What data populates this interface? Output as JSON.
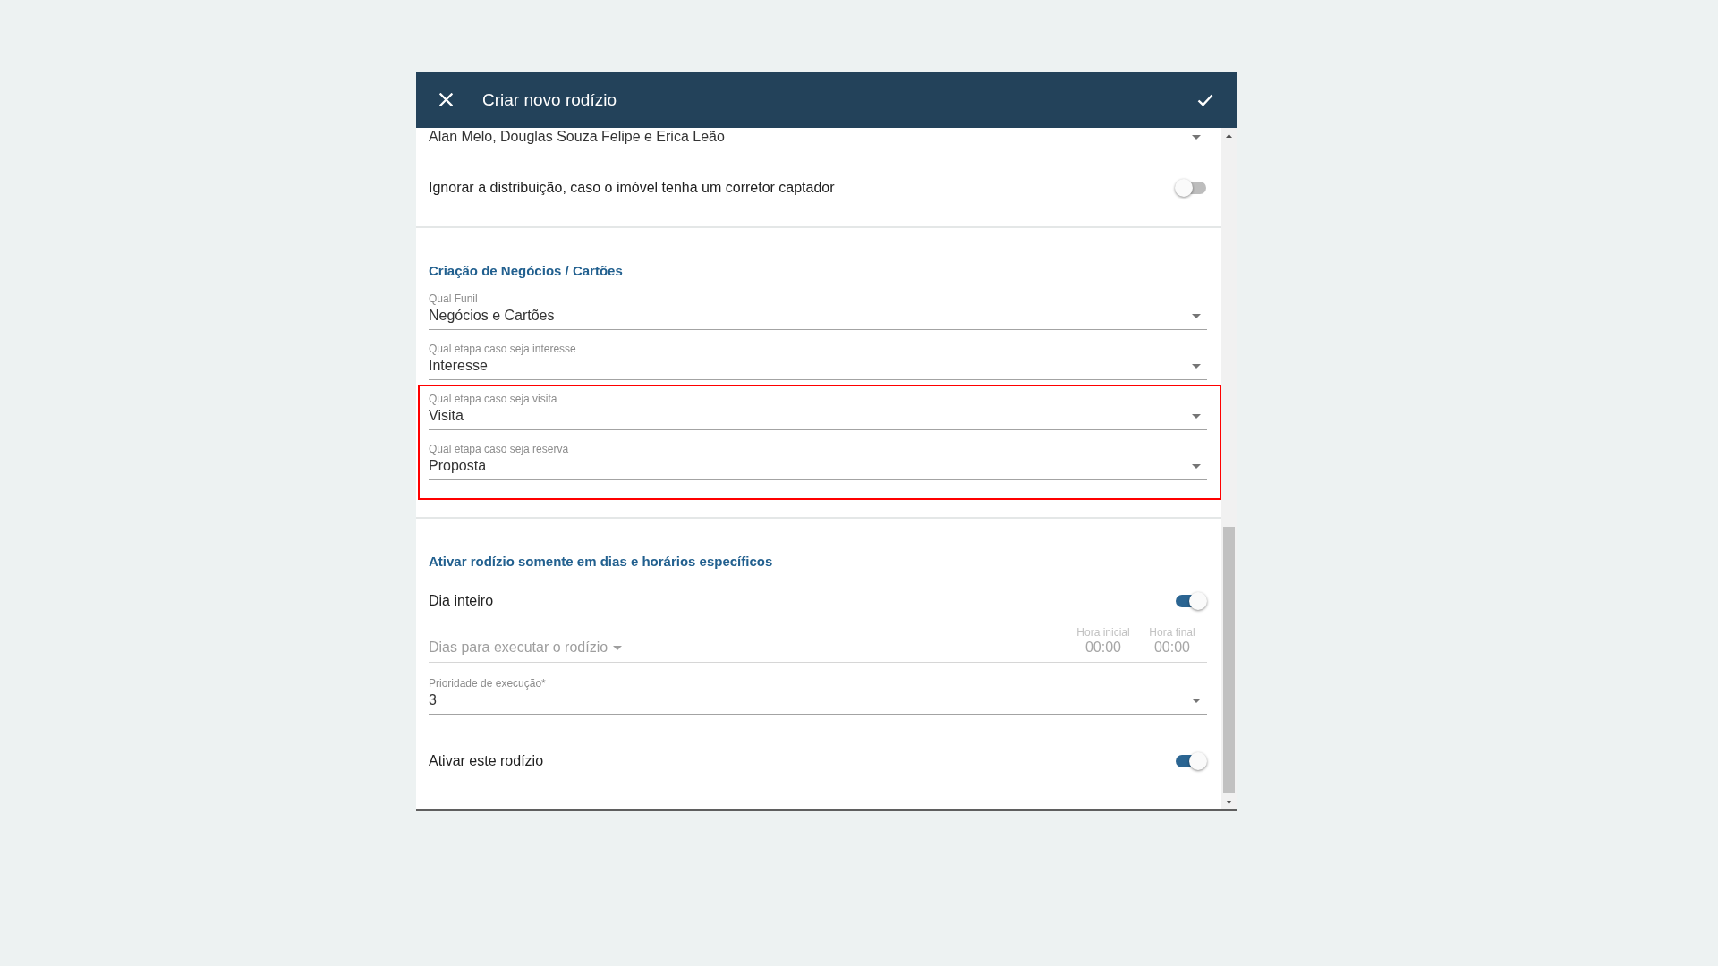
{
  "dialog": {
    "title": "Criar novo rodízio"
  },
  "sections": [
    {
      "items": [
        {
          "kind": "select",
          "value": "Alan Melo, Douglas Souza Felipe e Erica Leão"
        },
        {
          "kind": "toggle",
          "label": "Ignorar a distribuição, caso o imóvel tenha um corretor captador",
          "on": false
        }
      ]
    },
    {
      "title": "Criação de Negócios / Cartões",
      "items": [
        {
          "kind": "select",
          "label": "Qual Funil",
          "value": "Negócios e Cartões",
          "highlighted": false
        },
        {
          "kind": "select",
          "label": "Qual etapa caso seja interesse",
          "value": "Interesse",
          "highlighted": false
        },
        {
          "kind": "select",
          "label": "Qual etapa caso seja visita",
          "value": "Visita",
          "highlighted": true
        },
        {
          "kind": "select",
          "label": "Qual etapa caso seja reserva",
          "value": "Proposta",
          "highlighted": true
        }
      ]
    },
    {
      "title": "Ativar rodízio somente em dias e horários específicos",
      "items": [
        {
          "kind": "toggle",
          "label": "Dia inteiro",
          "on": true
        },
        {
          "kind": "schedule",
          "placeholder": "Dias para executar o rodízio",
          "disabled": true,
          "times": [
            {
              "label": "Hora inicial",
              "value": "00:00"
            },
            {
              "label": "Hora final",
              "value": "00:00"
            }
          ]
        },
        {
          "kind": "select",
          "label": "Prioridade de execução*",
          "value": "3"
        },
        {
          "kind": "toggle",
          "label": "Ativar este rodízio",
          "on": true
        }
      ]
    }
  ]
}
